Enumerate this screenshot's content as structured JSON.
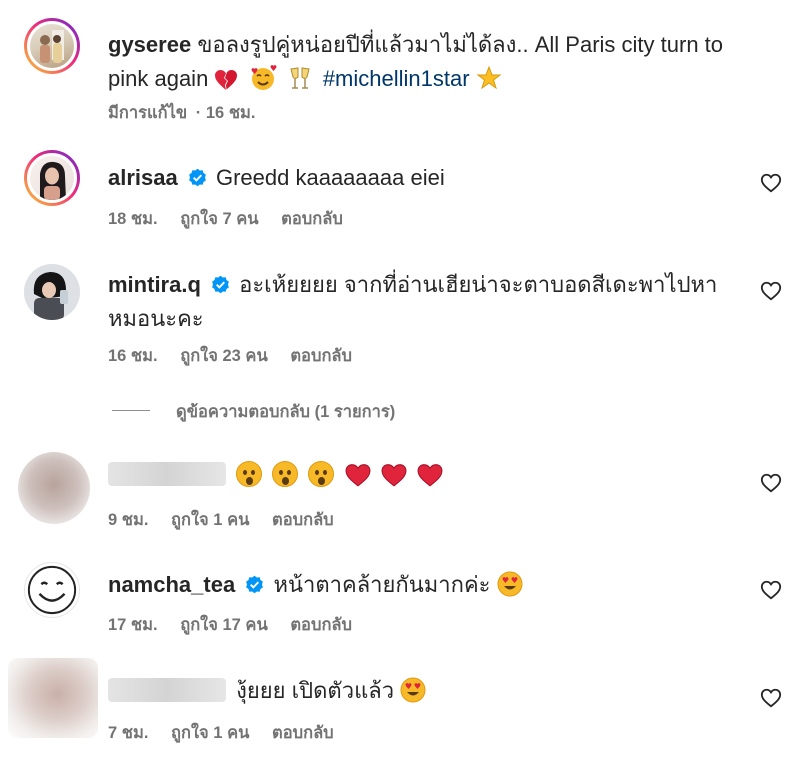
{
  "post": {
    "username": "gyseree",
    "caption_1": "ขอลงรูปคู่หน่อยปีที่แล้วมาไม่ได้ลง.. All Paris city turn to",
    "caption_2": "pink again",
    "hashtag": "#michellin1star",
    "edited": "มีการแก้ไข",
    "time": "· 16 ชม."
  },
  "comments": [
    {
      "username": "alrisaa",
      "text": "Greedd kaaaaaaaa eiei",
      "time": "18 ชม.",
      "likes": "ถูกใจ 7 คน",
      "reply": "ตอบกลับ"
    },
    {
      "username": "mintira.q",
      "text_1": "อะเห้ยยยย จากที่อ่านเฮียน่าจะตาบอดสีเดะพาไปหา",
      "text_2": "หมอนะคะ",
      "time": "16 ชม.",
      "likes": "ถูกใจ 23 คน",
      "reply": "ตอบกลับ"
    },
    {
      "time": "9 ชม.",
      "likes": "ถูกใจ 1 คน",
      "reply": "ตอบกลับ"
    },
    {
      "username": "namcha_tea",
      "text": "หน้าตาคล้ายกันมากค่ะ",
      "time": "17 ชม.",
      "likes": "ถูกใจ 17 คน",
      "reply": "ตอบกลับ"
    },
    {
      "text": "งุ้ยยย เปิดตัวแล้ว",
      "time": "7 ชม.",
      "likes": "ถูกใจ 1 คน",
      "reply": "ตอบกลับ"
    }
  ],
  "view_replies": "ดูข้อความตอบกลับ (1 รายการ)",
  "colors": {
    "verified": "#0095f6",
    "hashtag": "#00376b",
    "meta": "#737373"
  }
}
